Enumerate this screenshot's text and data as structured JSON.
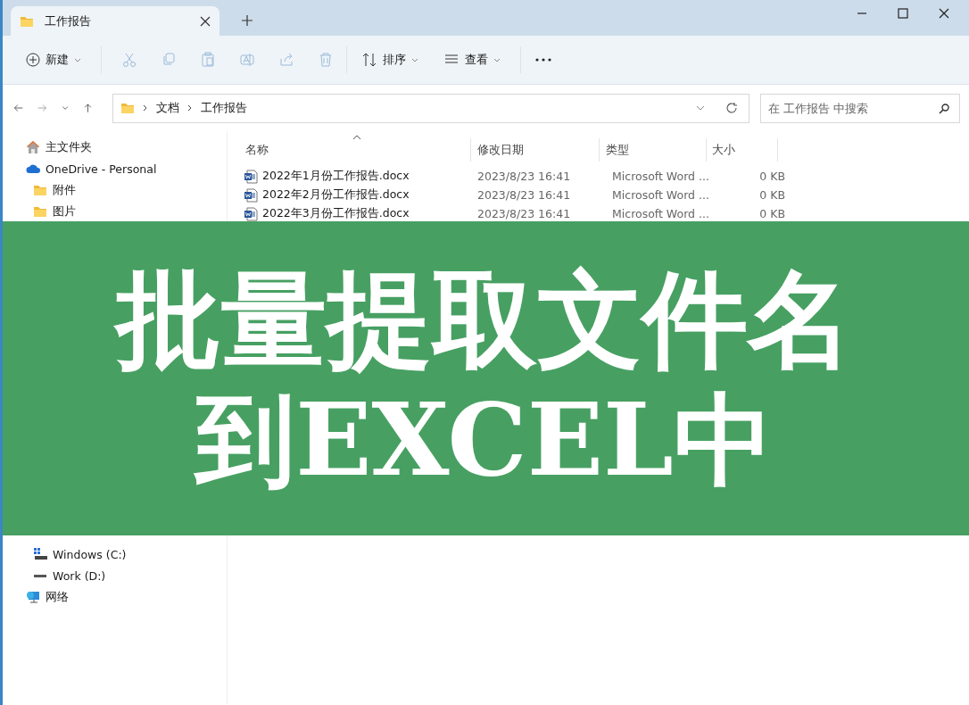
{
  "window": {
    "tab": {
      "title": "工作报告"
    }
  },
  "toolbar": {
    "new": "新建",
    "actions": [
      {
        "kind": "cut",
        "disabled": true
      },
      {
        "kind": "copy",
        "disabled": true
      },
      {
        "kind": "paste",
        "disabled": true
      },
      {
        "kind": "rename",
        "disabled": true
      },
      {
        "kind": "share",
        "disabled": true
      },
      {
        "kind": "delete",
        "disabled": true
      }
    ],
    "sort": "排序",
    "view": "查看"
  },
  "address": {
    "crumbs": [
      "文档",
      "工作报告"
    ]
  },
  "search": {
    "placeholder": "在 工作报告 中搜索"
  },
  "sidebar": {
    "items": [
      {
        "kind": "home",
        "label": "主文件夹"
      },
      {
        "kind": "cloud",
        "label": "OneDrive - Personal",
        "children": [
          {
            "kind": "folder",
            "label": "附件"
          },
          {
            "kind": "folder",
            "label": "图片"
          }
        ]
      },
      {
        "kind": "drive-windows",
        "label": "Windows (C:)"
      },
      {
        "kind": "drive",
        "label": "Work (D:)"
      },
      {
        "kind": "network",
        "label": "网络"
      }
    ]
  },
  "table": {
    "columns": [
      {
        "label": "名称",
        "sorted": true
      },
      {
        "label": "修改日期",
        "sorted": false
      },
      {
        "label": "类型",
        "sorted": false
      },
      {
        "label": "大小",
        "sorted": false
      }
    ],
    "rows": [
      {
        "name": "2022年1月份工作报告.docx",
        "modified": "2023/8/23 16:41",
        "type": "Microsoft Word ...",
        "size": "0 KB"
      },
      {
        "name": "2022年2月份工作报告.docx",
        "modified": "2023/8/23 16:41",
        "type": "Microsoft Word ...",
        "size": "0 KB"
      },
      {
        "name": "2022年3月份工作报告.docx",
        "modified": "2023/8/23 16:41",
        "type": "Microsoft Word ...",
        "size": "0 KB"
      }
    ]
  },
  "banner": {
    "lines": [
      "批量提取文件名",
      "到EXCEL中"
    ]
  }
}
